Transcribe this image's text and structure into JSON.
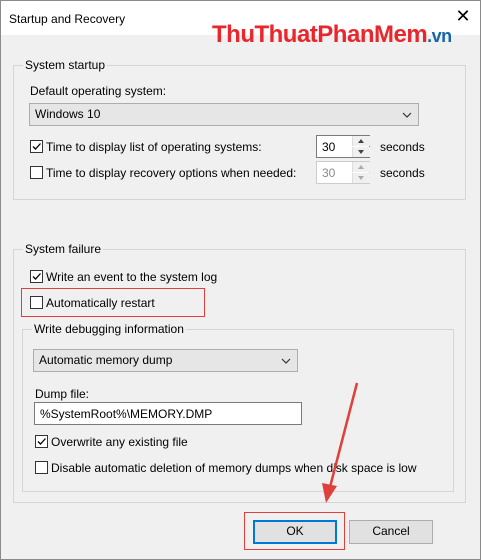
{
  "window": {
    "title": "Startup and Recovery",
    "close_glyph": "✕"
  },
  "watermark": {
    "brand": "ThuThuatPhanMem",
    "tld": ".vn"
  },
  "system_startup": {
    "legend": "System startup",
    "default_os_label": "Default operating system:",
    "default_os_value": "Windows 10",
    "display_list_label": "Time to display list of operating systems:",
    "display_list_checked": true,
    "display_list_value": "30",
    "display_list_unit": "seconds",
    "recovery_label": "Time to display recovery options when needed:",
    "recovery_checked": false,
    "recovery_value": "30",
    "recovery_unit": "seconds"
  },
  "system_failure": {
    "legend": "System failure",
    "write_event_label": "Write an event to the system log",
    "write_event_checked": true,
    "auto_restart_label": "Automatically restart",
    "auto_restart_checked": false
  },
  "debugging": {
    "legend": "Write debugging information",
    "dump_type_value": "Automatic memory dump",
    "dump_file_label": "Dump file:",
    "dump_file_value": "%SystemRoot%\\MEMORY.DMP",
    "overwrite_label": "Overwrite any existing file",
    "overwrite_checked": true,
    "disable_delete_label": "Disable automatic deletion of memory dumps when disk space is low",
    "disable_delete_checked": false
  },
  "buttons": {
    "ok": "OK",
    "cancel": "Cancel"
  },
  "colors": {
    "highlight": "#e0403c",
    "arrow": "#e0403c",
    "accent": "#0078d7"
  }
}
